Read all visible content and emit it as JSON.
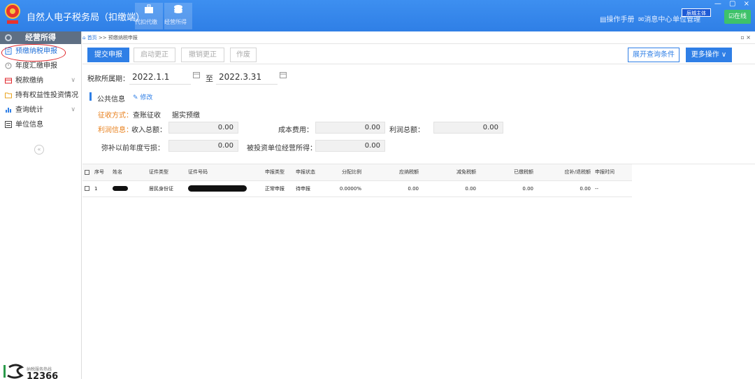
{
  "app": {
    "title": "自然人电子税务局（扣缴端）",
    "nav": [
      {
        "label": "代扣代缴",
        "icon": "briefcase-icon"
      },
      {
        "label": "经营所得",
        "icon": "coins-icon"
      }
    ],
    "top_links": [
      "操作手册",
      "消息中心",
      "单位管理"
    ],
    "badge": "辰城主体",
    "status": "在线",
    "window_controls": "— ▢ ×"
  },
  "sidebar": {
    "header": "经营所得",
    "items": [
      {
        "label": "预缴纳税申报",
        "icon": "doc-icon",
        "active": true,
        "chevron": ""
      },
      {
        "label": "年度汇缴申报",
        "icon": "clock-icon",
        "active": false,
        "chevron": ""
      },
      {
        "label": "税款缴纳",
        "icon": "wallet-icon",
        "active": false,
        "chevron": "∨"
      },
      {
        "label": "持有权益性投资情况",
        "icon": "folder-icon",
        "active": false,
        "chevron": ""
      },
      {
        "label": "查询统计",
        "icon": "chart-icon",
        "active": false,
        "chevron": "∨"
      },
      {
        "label": "单位信息",
        "icon": "list-icon",
        "active": false,
        "chevron": ""
      }
    ],
    "collapse": "«",
    "hotline_small": "纳税服务热线",
    "hotline_number": "12366"
  },
  "breadcrumb": {
    "home": "首页",
    "sep": ">>",
    "current": "预缴纳税申报"
  },
  "toolbar": {
    "submit": "提交申报",
    "start_correction": "启动更正",
    "cancel_correction": "撤销更正",
    "void": "作废",
    "expand_query": "展开查询条件",
    "more_ops": "更多操作"
  },
  "period": {
    "label": "税款所属期：",
    "start": "2022.1.1",
    "to": "至",
    "end": "2022.3.31"
  },
  "public_info": {
    "title": "公共信息",
    "edit": "修改",
    "collection_method_label": "征收方式：",
    "collection_method_value": "查账征收",
    "collection_method_extra": "据实预缴",
    "profit_label": "利润信息：",
    "income_total_label": "收入总额：",
    "income_total": "0.00",
    "cost_label": "成本费用：",
    "cost": "0.00",
    "profit_total_label": "利润总额：",
    "profit_total": "0.00",
    "loss_label": "弥补以前年度亏损：",
    "loss": "0.00",
    "invested_income_label": "被投资单位经营所得：",
    "invested_income": "0.00"
  },
  "table": {
    "columns": [
      "序号",
      "姓名",
      "证件类型",
      "证件号码",
      "申报类型",
      "申报状态",
      "分配比例",
      "应纳税额",
      "减免税额",
      "已缴税额",
      "应补/退税额",
      "申报时间"
    ],
    "rows": [
      {
        "seq": "1",
        "name": "",
        "id_type": "居民身份证",
        "id_number": "",
        "decl_type": "正常申报",
        "decl_status": "待申报",
        "ratio": "0.0000%",
        "tax_payable": "0.00",
        "tax_relief": "0.00",
        "tax_paid": "0.00",
        "tax_due": "0.00",
        "decl_time": "--"
      }
    ]
  },
  "colors": {
    "title_bar": "#2f7fe6",
    "primary": "#2f7fe6",
    "sidebar_header": "#5e6f84",
    "orange_label": "#e8801d",
    "online": "#3ec26a",
    "annotation": "#e0262b"
  }
}
